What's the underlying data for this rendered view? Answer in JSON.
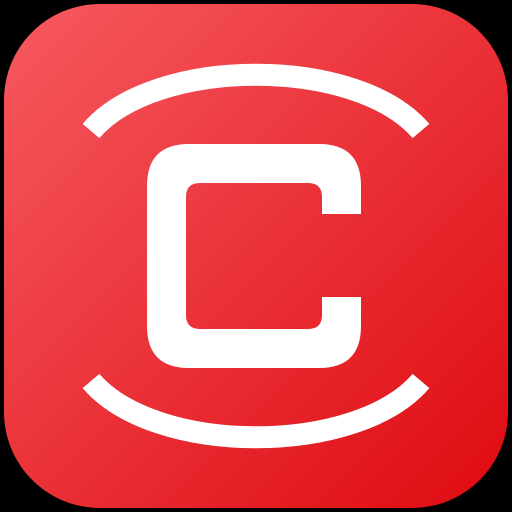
{
  "icon": {
    "name": "app-icon",
    "glyph": "C",
    "colors": {
      "background": "#000000",
      "gradient_start": "#F65A60",
      "gradient_end": "#DE0A10",
      "glyph": "#FFFFFF"
    }
  }
}
